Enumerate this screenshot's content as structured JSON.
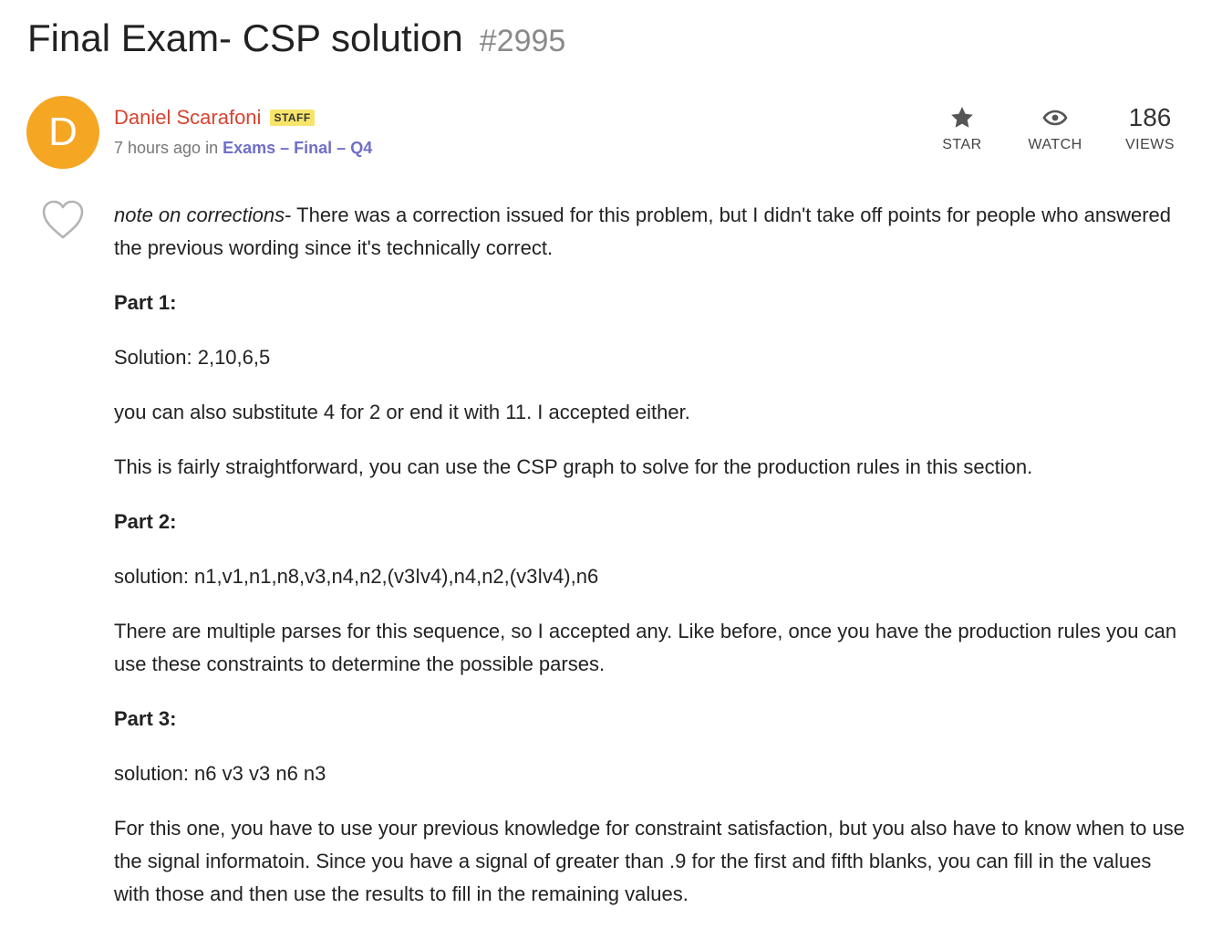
{
  "post": {
    "title": "Final Exam- CSP solution",
    "number": "#2995",
    "author": {
      "initial": "D",
      "name": "Daniel Scarafoni",
      "badge": "STAFF",
      "avatar_color": "#f5a623"
    },
    "meta": {
      "time": "7 hours ago",
      "in_word": "in",
      "category": "Exams – Final – Q4"
    },
    "actions": {
      "star_label": "STAR",
      "watch_label": "WATCH",
      "views_count": "186",
      "views_label": "VIEWS"
    },
    "like_icon": "heart-icon",
    "body": {
      "note_em": "note on corrections",
      "note_rest": "- There was a correction issued for this problem, but I didn't take off points for people who answered the previous wording since it's technically correct.",
      "part1_heading": "Part 1:",
      "part1_solution": "Solution: 2,10,6,5",
      "part1_alt": "you can also substitute 4 for 2 or end it with 11. I accepted either.",
      "part1_explain": "This is fairly straightforward, you can use the CSP graph to solve for the production rules in this section.",
      "part2_heading": "Part 2:",
      "part2_solution": "solution: n1,v1,n1,n8,v3,n4,n2,(v3ǀv4),n4,n2,(v3ǀv4),n6",
      "part2_explain": "There are multiple parses for this sequence, so I accepted any. Like before, once you have the production rules you can use these constraints to determine the possible parses.",
      "part3_heading": "Part 3:",
      "part3_solution": "solution: n6 v3 v3 n6 n3",
      "part3_explain": "For this one, you have to use your previous knowledge for constraint satisfaction, but you also have to know when to use the signal informatoin. Since you have a signal of greater than .9 for the first and fifth blanks, you can fill in the values with those and then use the results to fill in the remaining values."
    }
  },
  "colors": {
    "author_name": "#d9432f",
    "category_link": "#6f6fc8",
    "badge_bg": "#f7e46a"
  }
}
